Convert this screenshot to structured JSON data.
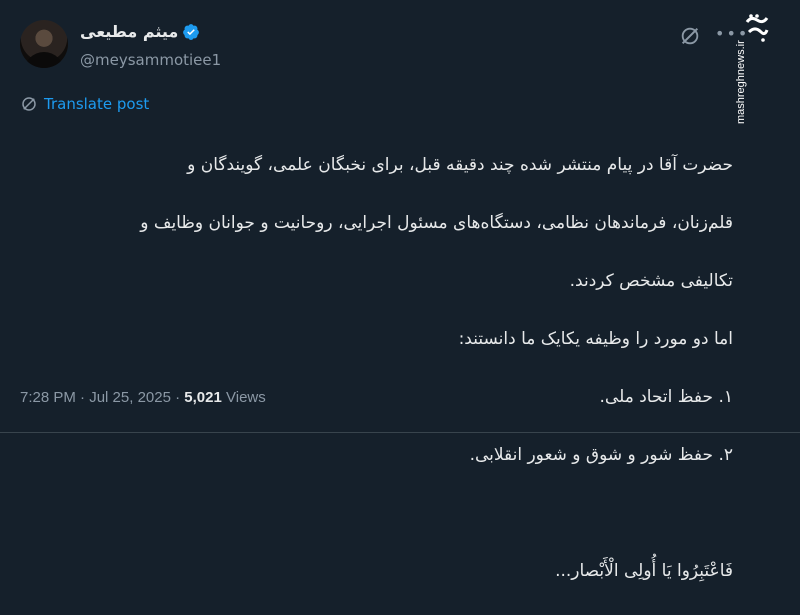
{
  "author": {
    "display_name": "میثم مطیعی",
    "handle": "@meysammotiee1"
  },
  "watermark": {
    "logo_text": "مشرق",
    "url": "mashreghnews.ir"
  },
  "translate_label": "Translate post",
  "body": {
    "lines": [
      "حضرت آقا در پیام منتشر شده چند دقیقه قبل، برای نخبگان علمی، گویندگان و",
      "قلم‌زنان، فرماندهان نظامی، دستگاه‌های مسئول اجرایی، روحانیت و جوانان وظایف و",
      "تکالیفی مشخص کردند.",
      "اما دو مورد را وظیفه یکایک ما دانستند:",
      "۱. حفظ اتحاد ملی.",
      "۲. حفظ شور و شوق و شعور انقلابی.",
      "",
      "فَاعْتَبِرُوا یَا أُولِی الْأَبْصار..."
    ]
  },
  "footer": {
    "time": "7:28 PM",
    "separator": "·",
    "date": "Jul 25, 2025",
    "views_count": "5,021",
    "views_label": "Views"
  },
  "colors": {
    "background": "#15202b",
    "text": "#e7e9ea",
    "muted": "#8b98a5",
    "accent": "#1d9bf0"
  },
  "icons": {
    "verified": "verified-badge-icon",
    "grok": "grok-icon",
    "more": "more-icon",
    "translate": "translate-globe-icon"
  }
}
